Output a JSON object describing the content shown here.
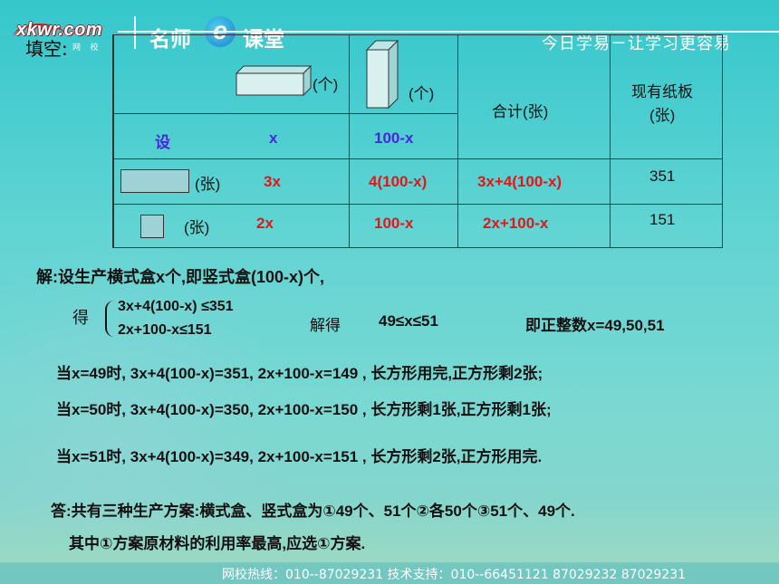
{
  "header": {
    "logo_text": "xkwr.com",
    "logo_sub": "网 校",
    "brand_left": "名师",
    "brand_mid": "e",
    "brand_right": "课堂",
    "slogan": "今日学易－让学习更容易"
  },
  "intro": "填空:",
  "table": {
    "col1_suffix": "(个)",
    "col2_suffix": "(个)",
    "col3_header": "合计(张)",
    "col4_header_line1": "现有纸板",
    "col4_header_line2": "(张)",
    "row_set": {
      "label": "设",
      "c1": "x",
      "c2": "100-x"
    },
    "row_rect": {
      "unit": "(张)",
      "c1": "3x",
      "c2": "4(100-x)",
      "c3": "3x+4(100-x)",
      "c4": "351"
    },
    "row_square": {
      "unit": "(张)",
      "c1": "2x",
      "c2": "100-x",
      "c3": "2x+100-x",
      "c4": "151"
    }
  },
  "solution": {
    "line1": "解:设生产横式盒x个,即竖式盒(100-x)个,",
    "de": "得",
    "ineq1": "3x+4(100-x) ≤351",
    "ineq2": "2x+100-x≤151",
    "jiede": "解得",
    "range": "49≤x≤51",
    "integers": "即正整数x=49,50,51",
    "case49": "当x=49时, 3x+4(100-x)=351,   2x+100-x=149  , 长方形用完,正方形剩2张;",
    "case50": "当x=50时, 3x+4(100-x)=350,   2x+100-x=150  , 长方形剩1张,正方形剩1张;",
    "case51": "当x=51时, 3x+4(100-x)=349,   2x+100-x=151  , 长方形剩2张,正方形用完.",
    "answer1": "答:共有三种生产方案:横式盒、竖式盒为①49个、51个②各50个③51个、49个.",
    "answer2": "其中①方案原材料的利用率最高,应选①方案."
  },
  "footer": {
    "text": "网校热线：010--87029231    技术支持：010--66451121 87029232 87029231"
  }
}
